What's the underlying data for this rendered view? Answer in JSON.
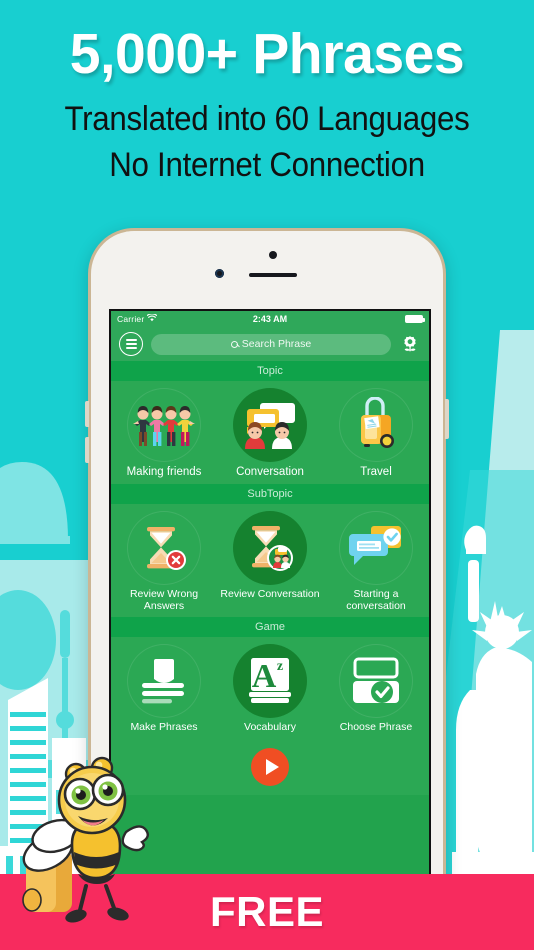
{
  "promo": {
    "title": "5,000+ Phrases",
    "subtitle_1": "Translated into 60 Languages",
    "subtitle_2": "No Internet Connection",
    "banner_label": "FREE",
    "background_color": "#18cfd0",
    "banner_color": "#f72b5e",
    "title_color": "#ffffff",
    "subtitle_color": "#111111"
  },
  "app": {
    "accent_green": "#2ba854",
    "header_green": "#0fa34a",
    "selected_green": "#15822f",
    "play_color": "#f04e23",
    "status_bar": {
      "carrier": "Carrier",
      "wifi_icon": "wifi-icon",
      "time": "2:43 AM",
      "battery_icon": "battery-full-icon"
    },
    "nav_bar": {
      "menu_icon": "hamburger-menu-icon",
      "search_icon": "search-icon",
      "search_placeholder": "Search Phrase",
      "search_value": "",
      "settings_icon": "flower-gear-settings-icon"
    },
    "sections": [
      {
        "header": "Topic",
        "tiles": [
          {
            "label": "Making friends",
            "icon": "group-of-friends-icon",
            "selected": false
          },
          {
            "label": "Conversation",
            "icon": "speech-bubbles-people-icon",
            "selected": true
          },
          {
            "label": "Travel",
            "icon": "rolling-suitcase-icon",
            "selected": false
          }
        ]
      },
      {
        "header": "SubTopic",
        "tiles": [
          {
            "label": "Review Wrong Answers",
            "icon": "hourglass-error-icon",
            "selected": false
          },
          {
            "label": "Review Conversation",
            "icon": "hourglass-conversation-icon",
            "selected": true
          },
          {
            "label": "Starting a conversation",
            "icon": "chat-check-icon",
            "selected": false
          }
        ]
      },
      {
        "header": "Game",
        "tiles": [
          {
            "label": "Make Phrases",
            "icon": "write-phrases-icon",
            "selected": false
          },
          {
            "label": "Vocabulary",
            "icon": "a-to-z-book-icon",
            "selected": true
          },
          {
            "label": "Choose Phrase",
            "icon": "choose-card-check-icon",
            "selected": false
          }
        ]
      }
    ],
    "play_button": {
      "icon": "play-icon",
      "label": ""
    }
  },
  "decor": {
    "bee_mascot": "bee-with-suitcase-mascot",
    "skyline_left": "city-landmarks-silhouette",
    "skyline_right": "statue-of-liberty-silhouette"
  }
}
